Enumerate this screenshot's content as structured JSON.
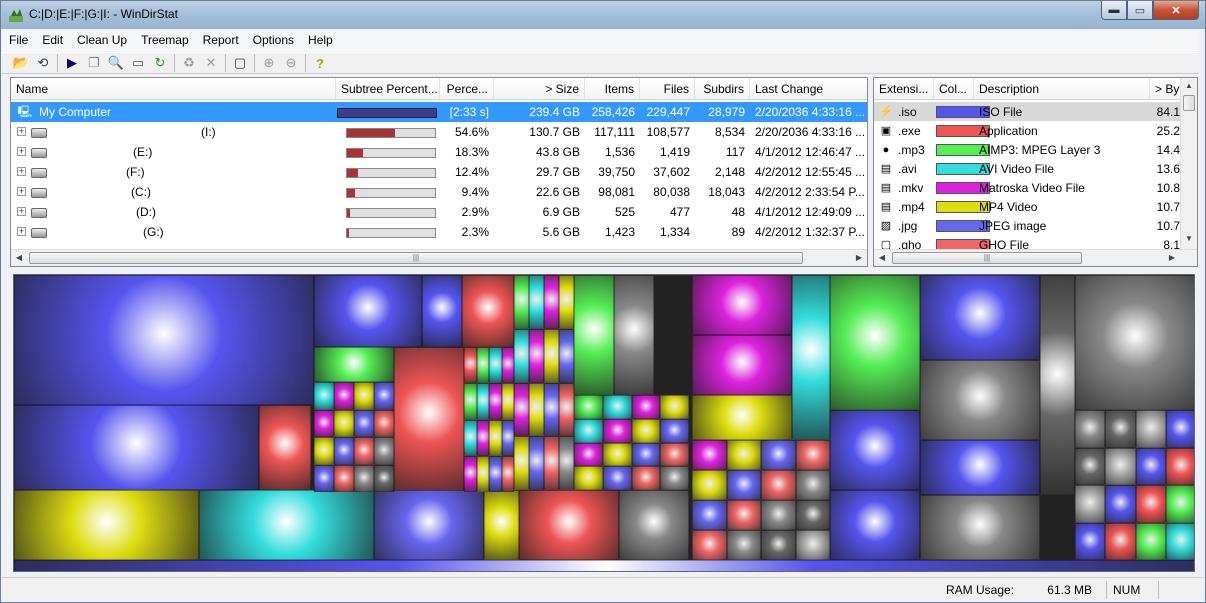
{
  "window": {
    "title": "C:|D:|E:|F:|G:|I: - WinDirStat",
    "buttons": {
      "minimize": "▬",
      "maximize": "▭",
      "close": "✕"
    }
  },
  "menu": [
    "File",
    "Edit",
    "Clean Up",
    "Treemap",
    "Report",
    "Options",
    "Help"
  ],
  "directory_list": {
    "columns": [
      "Name",
      "Subtree Percent...",
      "Perce...",
      "> Size",
      "Items",
      "Files",
      "Subdirs",
      "Last Change"
    ],
    "rows": [
      {
        "name": "My Computer",
        "subtree": 1.0,
        "percent": "[2:33 s]",
        "size": "239.4 GB",
        "items": "258,426",
        "files": "229,447",
        "subdirs": "28,979",
        "last_change": "2/20/2036  4:33:16 ...",
        "selected": true
      },
      {
        "name": "(I:)",
        "subtree": 0.546,
        "percent": "54.6%",
        "size": "130.7 GB",
        "items": "117,111",
        "files": "108,577",
        "subdirs": "8,534",
        "last_change": "2/20/2036  4:33:16 ..."
      },
      {
        "name": "(E:)",
        "subtree": 0.183,
        "percent": "18.3%",
        "size": "43.8 GB",
        "items": "1,536",
        "files": "1,419",
        "subdirs": "117",
        "last_change": "4/1/2012  12:46:47 ..."
      },
      {
        "name": "(F:)",
        "subtree": 0.124,
        "percent": "12.4%",
        "size": "29.7 GB",
        "items": "39,750",
        "files": "37,602",
        "subdirs": "2,148",
        "last_change": "4/2/2012  12:55:45 ..."
      },
      {
        "name": "(C:)",
        "subtree": 0.094,
        "percent": "9.4%",
        "size": "22.6 GB",
        "items": "98,081",
        "files": "80,038",
        "subdirs": "18,043",
        "last_change": "4/2/2012  2:33:54 P..."
      },
      {
        "name": "(D:)",
        "subtree": 0.029,
        "percent": "2.9%",
        "size": "6.9 GB",
        "items": "525",
        "files": "477",
        "subdirs": "48",
        "last_change": "4/1/2012  12:49:09 ..."
      },
      {
        "name": "(G:)",
        "subtree": 0.023,
        "percent": "2.3%",
        "size": "5.6 GB",
        "items": "1,423",
        "files": "1,334",
        "subdirs": "89",
        "last_change": "4/2/2012  1:32:37 P..."
      }
    ]
  },
  "extension_list": {
    "columns": [
      "Extensi...",
      "Col...",
      "Description",
      "> By"
    ],
    "rows": [
      {
        "ext": ".iso",
        "color": "#5555ee",
        "description": "ISO File",
        "bytes": "84.1",
        "icon": "⚡",
        "selected": true
      },
      {
        "ext": ".exe",
        "color": "#ee5555",
        "description": "Application",
        "bytes": "25.2",
        "icon": "▣"
      },
      {
        "ext": ".mp3",
        "color": "#55ee55",
        "description": "AIMP3: MPEG Layer 3",
        "bytes": "14.4",
        "icon": "●"
      },
      {
        "ext": ".avi",
        "color": "#33dddd",
        "description": "AVI Video File",
        "bytes": "13.6",
        "icon": "▤"
      },
      {
        "ext": ".mkv",
        "color": "#dd22dd",
        "description": "Matroska Video File",
        "bytes": "10.8",
        "icon": "▤"
      },
      {
        "ext": ".mp4",
        "color": "#dddd11",
        "description": "MP4 Video",
        "bytes": "10.7",
        "icon": "▤"
      },
      {
        "ext": ".jpg",
        "color": "#6666ee",
        "description": "JPEG image",
        "bytes": "10.7",
        "icon": "▨"
      },
      {
        "ext": ".gho",
        "color": "#ee6666",
        "description": "GHO File",
        "bytes": "8.1",
        "icon": "▢"
      }
    ]
  },
  "scroll_grip": "|||",
  "status": {
    "ram_label": "RAM Usage:",
    "ram_value": "61.3 MB",
    "num": "NUM"
  }
}
